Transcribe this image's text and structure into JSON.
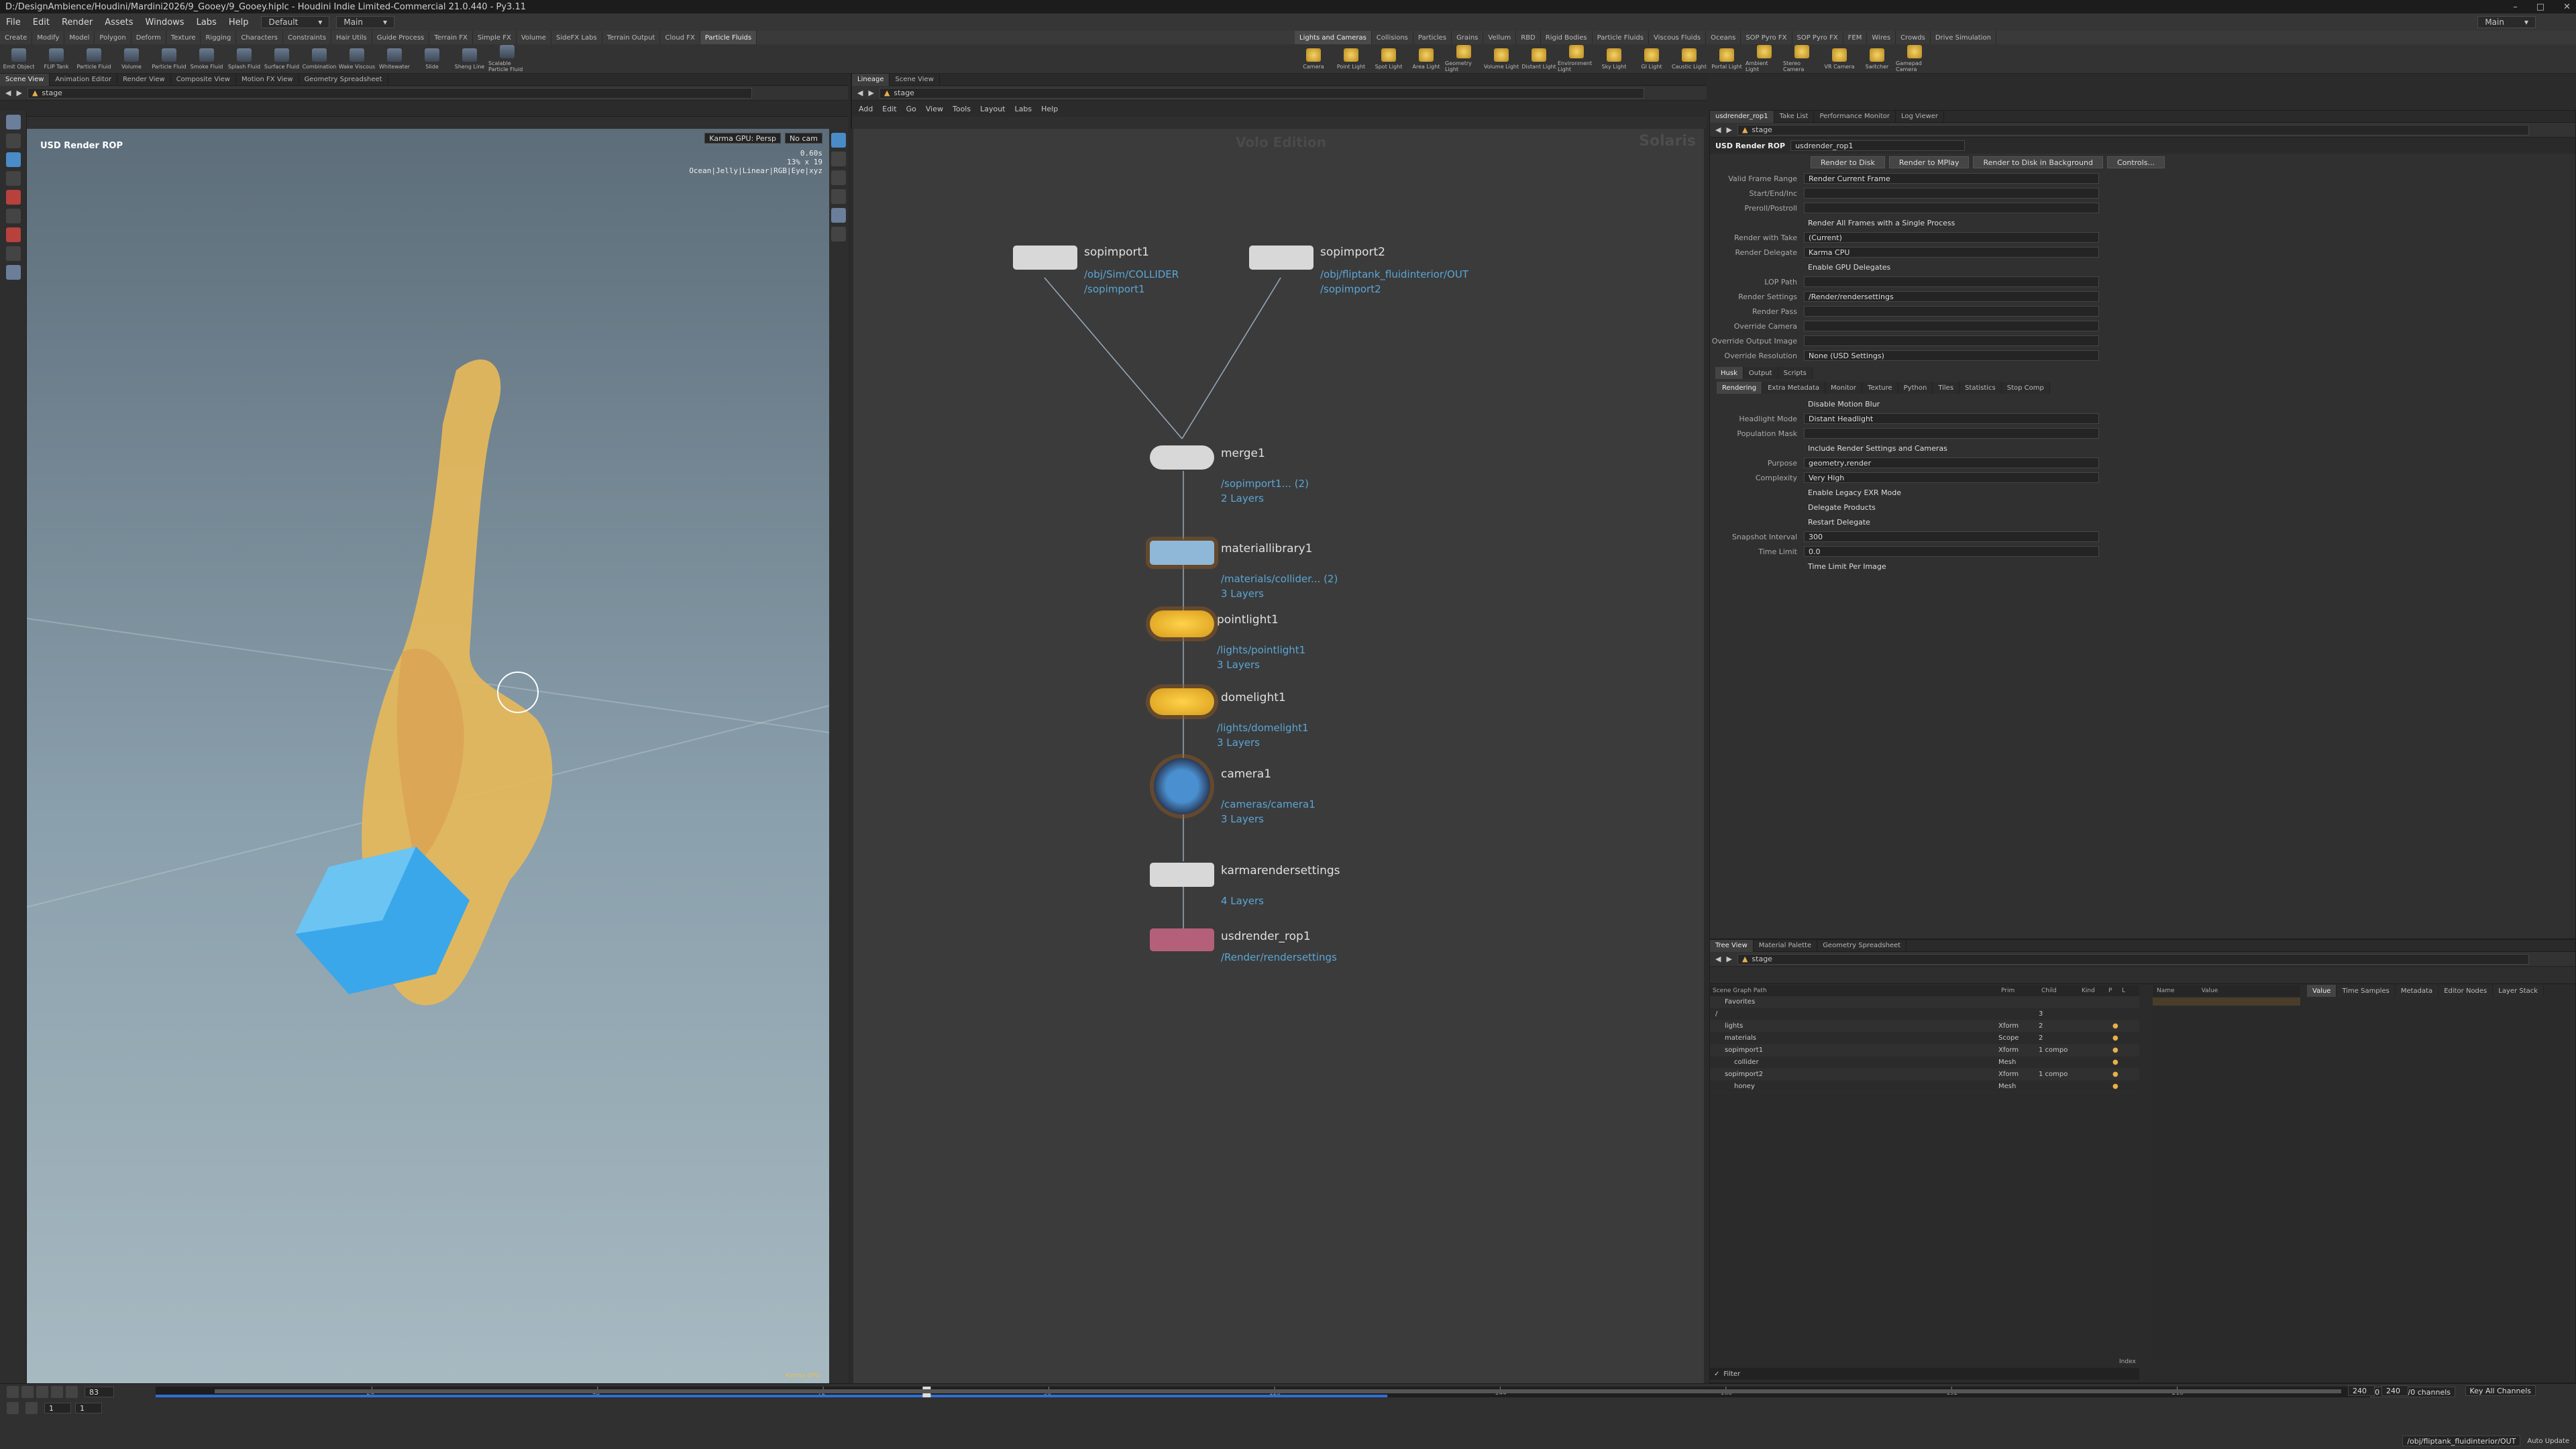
{
  "window": {
    "title": "D:/DesignAmbience/Houdini/Mardini2026/9_Gooey/9_Gooey.hiplc - Houdini Indie Limited-Commercial 21.0.440 - Py3.11"
  },
  "menu": {
    "items": [
      "File",
      "Edit",
      "Render",
      "Assets",
      "Windows",
      "Labs",
      "Help"
    ],
    "desktop": "Default",
    "context": "Main",
    "right_context": "Main"
  },
  "shelf": {
    "left_tabs": [
      "Create",
      "Modify",
      "Model",
      "Polygon",
      "Deform",
      "Texture",
      "Rigging",
      "Characters",
      "Constraints",
      "Hair Utils",
      "Guide Process",
      "Terrain FX",
      "Simple FX",
      "Volume",
      "SideFX Labs",
      "Terrain Output",
      "Cloud FX",
      "Particle Fluids"
    ],
    "left_tools": [
      "Emit Object",
      "FLIP Tank",
      "Particle Fluid",
      "Volume",
      "Particle Fluid",
      "Smoke Fluid",
      "Splash Fluid",
      "Surface Fluid",
      "Combination",
      "Wake Viscous",
      "Whitewater",
      "Slide",
      "Sheng Line",
      "Scalable Particle Fluid"
    ],
    "right_tabs": [
      "Lights and Cameras",
      "Collisions",
      "Particles",
      "Grains",
      "Vellum",
      "RBD",
      "Rigid Bodies",
      "Particle Fluids",
      "Viscous Fluids",
      "Oceans",
      "SOP Pyro FX",
      "SOP Pyro FX",
      "FEM",
      "Wires",
      "Crowds",
      "Drive Simulation"
    ],
    "right_tools": [
      "Camera",
      "Point Light",
      "Spot Light",
      "Area Light",
      "Geometry Light",
      "Volume Light",
      "Distant Light",
      "Environment Light",
      "Sky Light",
      "GI Light",
      "Caustic Light",
      "Portal Light",
      "Ambient Light",
      "Stereo Camera",
      "VR Camera",
      "Switcher",
      "Gamepad Camera"
    ]
  },
  "viewport_pane": {
    "tabs": [
      "Scene View",
      "Animation Editor",
      "Render View",
      "Composite View",
      "Motion FX View",
      "Geometry Spreadsheet"
    ],
    "path": "stage",
    "label": "USD Render ROP",
    "renderer": "Karma GPU: Persp",
    "camera": "No cam",
    "stats": [
      "0.60s",
      "13% x 19"
    ],
    "status_line": "Ocean|Jelly|Linear|RGB|Eye|xyz",
    "bottom_badge": "Karma GPU"
  },
  "network_pane": {
    "tabs": [
      "Lineage",
      "Scene View"
    ],
    "path": "stage",
    "menus": [
      "Add",
      "Edit",
      "Go",
      "View",
      "Tools",
      "Layout",
      "Labs",
      "Help"
    ],
    "watermark_center": "Volo Edition",
    "watermark_right": "Solaris",
    "nodes": [
      {
        "name": "sopimport1",
        "paths": [
          "/obj/Sim/COLLIDER",
          "/sopimport1"
        ]
      },
      {
        "name": "sopimport2",
        "paths": [
          "/obj/fliptank_fluidinterior/OUT",
          "/sopimport2"
        ]
      },
      {
        "name": "merge1",
        "paths": [
          "/sopimport1... (2)",
          "2 Layers"
        ]
      },
      {
        "name": "materiallibrary1",
        "paths": [
          "/materials/collider... (2)",
          "3 Layers"
        ]
      },
      {
        "name": "pointlight1",
        "paths": [
          "/lights/pointlight1",
          "3 Layers"
        ]
      },
      {
        "name": "domelight1",
        "paths": [
          "/lights/domelight1",
          "3 Layers"
        ]
      },
      {
        "name": "camera1",
        "paths": [
          "/cameras/camera1",
          "3 Layers"
        ]
      },
      {
        "name": "karmarendersettings",
        "paths": [
          "4 Layers"
        ]
      },
      {
        "name": "usdrender_rop1",
        "paths": [
          "/Render/rendersettings"
        ]
      }
    ]
  },
  "params_pane": {
    "tabs": [
      "usdrender_rop1",
      "Take List",
      "Performance Monitor",
      "Log Viewer"
    ],
    "path": "stage",
    "node_type": "USD Render ROP",
    "node_name": "usdrender_rop1",
    "buttons": [
      "Render to Disk",
      "Render to MPlay",
      "Render to Disk in Background",
      "Controls..."
    ],
    "rows": [
      {
        "label": "Valid Frame Range",
        "value": "Render Current Frame"
      },
      {
        "label": "Start/End/Inc",
        "value": ""
      },
      {
        "label": "Preroll/Postroll",
        "value": ""
      },
      {
        "label": "",
        "value": "Render All Frames with a Single Process"
      },
      {
        "label": "Render with Take",
        "value": "(Current)"
      },
      {
        "label": "Render Delegate",
        "value": "Karma CPU"
      },
      {
        "label": "",
        "value": "Enable GPU Delegates"
      },
      {
        "label": "LOP Path",
        "value": ""
      },
      {
        "label": "Render Settings",
        "value": "/Render/rendersettings"
      },
      {
        "label": "Render Pass",
        "value": ""
      },
      {
        "label": "Override Camera",
        "value": ""
      },
      {
        "label": "Override Output Image",
        "value": ""
      },
      {
        "label": "Override Resolution",
        "value": "None (USD Settings)"
      }
    ],
    "section_tabs": [
      "Husk",
      "Output",
      "Scripts"
    ],
    "husk_tabs": [
      "Rendering",
      "Extra Metadata",
      "Monitor",
      "Texture",
      "Python",
      "Tiles",
      "Statistics",
      "Stop Comp"
    ],
    "husk_rows": [
      {
        "label": "",
        "value": "Disable Motion Blur"
      },
      {
        "label": "Headlight Mode",
        "value": "Distant Headlight"
      },
      {
        "label": "Population Mask",
        "value": ""
      },
      {
        "label": "",
        "value": "Include Render Settings and Cameras"
      },
      {
        "label": "Purpose",
        "value": "geometry,render"
      },
      {
        "label": "Complexity",
        "value": "Very High"
      },
      {
        "label": "",
        "value": "Enable Legacy EXR Mode"
      },
      {
        "label": "",
        "value": "Delegate Products"
      },
      {
        "label": "",
        "value": "Restart Delegate"
      },
      {
        "label": "Snapshot Interval",
        "value": "300"
      },
      {
        "label": "Time Limit",
        "value": "0.0"
      },
      {
        "label": "",
        "value": "Time Limit Per Image"
      }
    ]
  },
  "scenegraph_pane": {
    "tabs": [
      "Tree View",
      "Material Palette",
      "Geometry Spreadsheet"
    ],
    "path": "stage",
    "columns": [
      "Scene Graph Path",
      "Prim",
      "Child",
      "Kind",
      "P",
      "L"
    ],
    "rows": [
      {
        "path": "Favorites",
        "type": "",
        "child": ""
      },
      {
        "path": "/",
        "type": "",
        "child": "3"
      },
      {
        "path": "lights",
        "type": "Xform",
        "child": "2"
      },
      {
        "path": "materials",
        "type": "Scope",
        "child": "2"
      },
      {
        "path": "sopimport1",
        "type": "Xform",
        "child": "1 compo"
      },
      {
        "path": "collider",
        "type": "Mesh",
        "child": ""
      },
      {
        "path": "sopimport2",
        "type": "Xform",
        "child": "1 compo"
      },
      {
        "path": "honey",
        "type": "Mesh",
        "child": ""
      }
    ],
    "side_headers": [
      "Name",
      "Value"
    ],
    "detail_tabs": [
      "Value",
      "Time Samples",
      "Metadata",
      "Editor Nodes",
      "Layer Stack"
    ],
    "filter": "Filter",
    "index_label": "Index"
  },
  "timeline": {
    "frame": "83",
    "start": "1",
    "start2": "1",
    "end": "240",
    "end2": "240",
    "playhead_frame": 83,
    "cache_end_frame": 132,
    "ticks": [
      "24",
      "48",
      "72",
      "96",
      "120",
      "144",
      "168",
      "192",
      "216",
      "240"
    ],
    "keys_label": "0 keys, 0/0 channels",
    "key_all": "Key All Channels",
    "status": "/obj/fliptank_fluidinterior/OUT",
    "auto_update": "Auto Update"
  }
}
